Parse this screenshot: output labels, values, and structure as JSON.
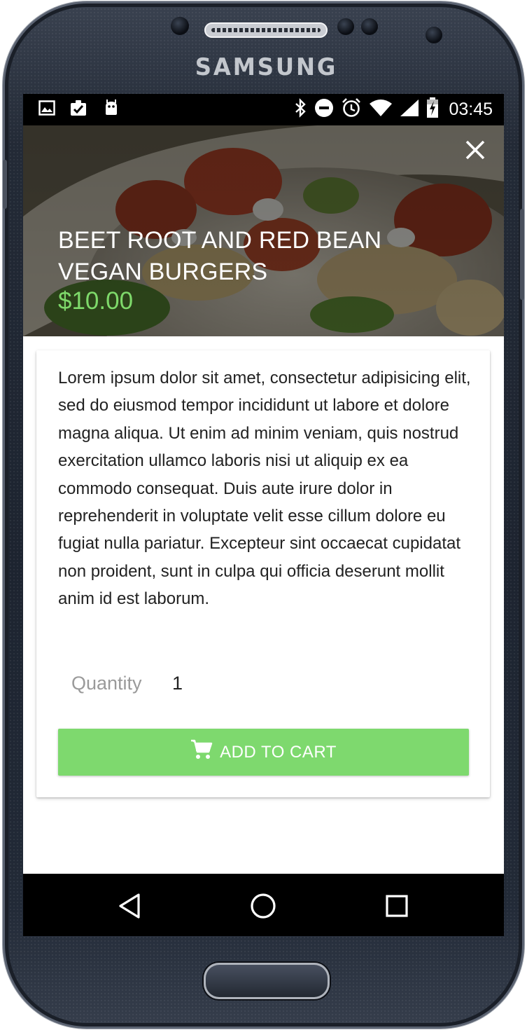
{
  "device": {
    "brand": "SAMSUNG"
  },
  "status_bar": {
    "left_icons": [
      "image-icon",
      "clipboard-check-icon",
      "android-icon"
    ],
    "right_icons": [
      "bluetooth-icon",
      "do-not-disturb-icon",
      "alarm-icon",
      "wifi-icon",
      "signal-icon",
      "battery-charging-icon"
    ],
    "time": "03:45"
  },
  "product": {
    "title": "BEET ROOT AND RED BEAN VEGAN BURGERS",
    "price": "$10.00",
    "description": "Lorem ipsum dolor sit amet, consectetur adipisicing elit, sed do eiusmod tempor incididunt ut labore et dolore magna aliqua. Ut enim ad minim veniam, quis nostrud exercitation ullamco laboris nisi ut aliquip ex ea commodo consequat. Duis aute irure dolor in reprehenderit in voluptate velit esse cillum dolore eu fugiat nulla pariatur. Excepteur sint occaecat cupidatat non proident, sunt in culpa qui officia deserunt mollit anim id est laborum."
  },
  "quantity": {
    "label": "Quantity",
    "value": "1"
  },
  "cart_button": {
    "label": "ADD TO CART",
    "icon": "cart-icon"
  },
  "nav_bar": {
    "buttons": [
      "back-icon",
      "home-icon",
      "recents-icon"
    ]
  },
  "colors": {
    "accent_green": "#7ed96e",
    "price_green": "#7ed96a",
    "status_bar": "#000000",
    "text_primary": "#222222",
    "text_secondary": "#9a9a9a"
  }
}
